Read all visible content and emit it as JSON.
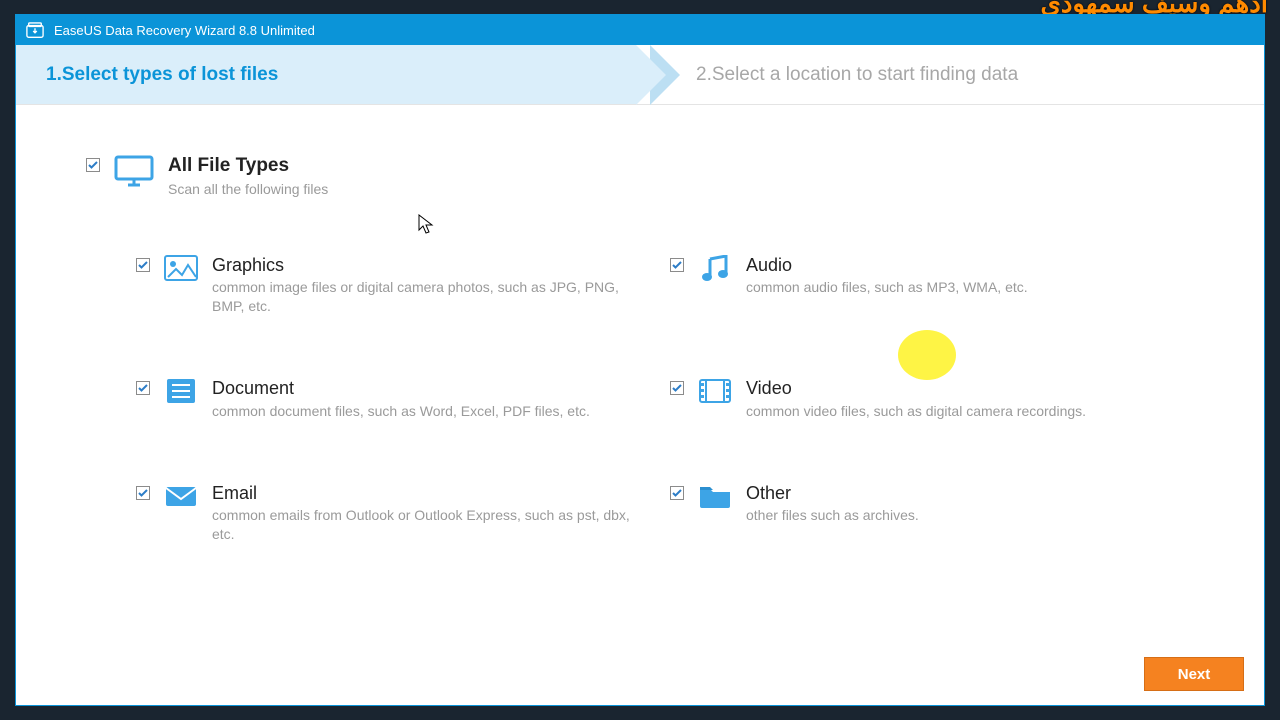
{
  "watermark": "ادهم وسيف سمهودي",
  "titlebar": {
    "app_title": "EaseUS Data Recovery Wizard 8.8 Unlimited"
  },
  "steps": {
    "step1": "1.Select types of lost files",
    "step2": "2.Select a location to start finding data"
  },
  "all_option": {
    "title": "All File Types",
    "desc": "Scan all the following files"
  },
  "options": {
    "graphics": {
      "title": "Graphics",
      "desc": "common image files or digital camera photos, such as JPG, PNG, BMP, etc."
    },
    "audio": {
      "title": "Audio",
      "desc": "common audio files, such as MP3, WMA, etc."
    },
    "document": {
      "title": "Document",
      "desc": "common document files, such as Word, Excel, PDF files, etc."
    },
    "video": {
      "title": "Video",
      "desc": "common video files, such as digital camera recordings."
    },
    "email": {
      "title": "Email",
      "desc": "common emails from Outlook or Outlook Express, such as pst, dbx, etc."
    },
    "other": {
      "title": "Other",
      "desc": "other files such as archives."
    }
  },
  "buttons": {
    "next": "Next"
  },
  "colors": {
    "primary": "#0b94d8",
    "accent": "#f58220",
    "highlight": "#fef445"
  }
}
